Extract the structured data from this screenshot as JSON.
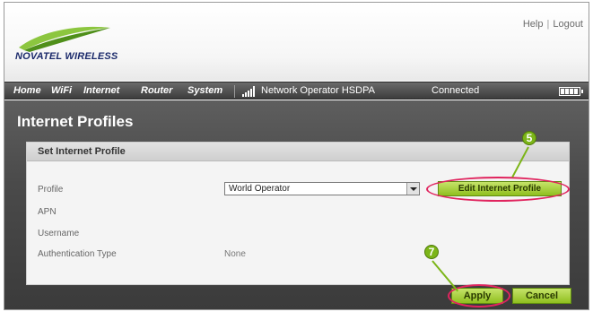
{
  "header": {
    "brand": "NOVATEL WIRELESS",
    "links": [
      "Help",
      "Logout"
    ],
    "link_separator": "|"
  },
  "navbar": {
    "items": [
      "Home",
      "WiFi",
      "Internet",
      "Router",
      "System"
    ],
    "network_operator": "Network Operator HSDPA",
    "status": "Connected",
    "icons": [
      "signal-strength-icon",
      "battery-icon"
    ]
  },
  "page": {
    "title": "Internet Profiles"
  },
  "panel": {
    "heading": "Set Internet Profile",
    "fields": {
      "profile_label": "Profile",
      "profile_value": "World Operator",
      "apn_label": "APN",
      "username_label": "Username",
      "auth_label": "Authentication Type",
      "auth_value": "None"
    },
    "edit_button": "Edit Internet Profile"
  },
  "actions": {
    "apply": "Apply",
    "cancel": "Cancel"
  },
  "callouts": {
    "step_edit": "5",
    "step_apply": "7"
  },
  "colors": {
    "nav_bg": "#4a4a4a",
    "content_bg": "#4a4a4a",
    "button_green": "#9ccc2e",
    "highlight_ring": "#e0245e",
    "callout_green": "#7cb518",
    "brand_blue": "#1b2a6b"
  }
}
